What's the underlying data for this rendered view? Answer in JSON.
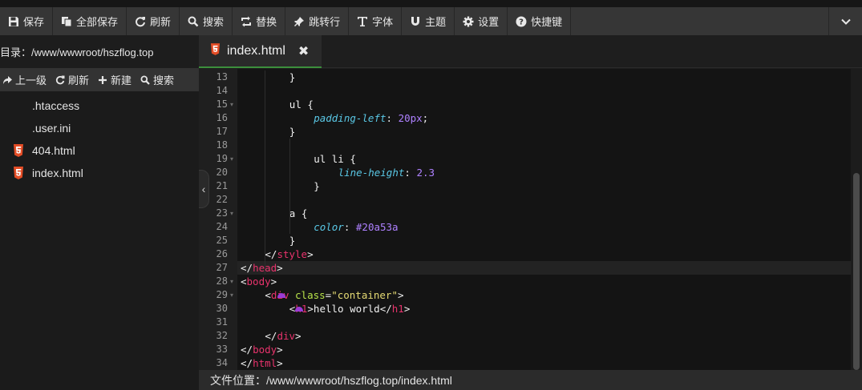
{
  "toolbar": {
    "buttons": [
      {
        "label": "保存",
        "icon": "floppy-icon"
      },
      {
        "label": "全部保存",
        "icon": "copy-icon"
      },
      {
        "label": "刷新",
        "icon": "refresh-icon"
      },
      {
        "label": "搜索",
        "icon": "search-icon"
      },
      {
        "label": "替换",
        "icon": "replace-icon"
      },
      {
        "label": "跳转行",
        "icon": "pin-icon"
      },
      {
        "label": "字体",
        "icon": "text-icon"
      },
      {
        "label": "主题",
        "icon": "magnet-icon"
      },
      {
        "label": "设置",
        "icon": "gear-icon"
      },
      {
        "label": "快捷键",
        "icon": "help-icon"
      }
    ],
    "collapse_icon": "chevron-down-icon"
  },
  "sidebar": {
    "directory_label": "目录：/www/wwwroot/hszflog.top",
    "nav": [
      {
        "label": "上一级",
        "icon": "share-icon"
      },
      {
        "label": "刷新",
        "icon": "refresh-icon"
      },
      {
        "label": "新建",
        "icon": "plus-icon"
      },
      {
        "label": "搜索",
        "icon": "search-icon"
      }
    ],
    "files": [
      {
        "name": ".htaccess",
        "icon": "blank-file-icon"
      },
      {
        "name": ".user.ini",
        "icon": "blank-file-icon"
      },
      {
        "name": "404.html",
        "icon": "html5-icon"
      },
      {
        "name": "index.html",
        "icon": "html5-icon"
      }
    ]
  },
  "tab": {
    "label": "index.html",
    "close": "✖"
  },
  "editor": {
    "lines": [
      {
        "num": "13",
        "fold": "",
        "indent": 8,
        "tokens": [
          {
            "t": "}",
            "c": "plain"
          }
        ]
      },
      {
        "num": "14",
        "fold": "",
        "indent": 0,
        "tokens": []
      },
      {
        "num": "15",
        "fold": "▾",
        "indent": 8,
        "tokens": [
          {
            "t": "ul {",
            "c": "plain"
          }
        ]
      },
      {
        "num": "16",
        "fold": "",
        "indent": 12,
        "tokens": [
          {
            "t": "padding-left",
            "c": "prop"
          },
          {
            "t": ": ",
            "c": "plain"
          },
          {
            "t": "20px",
            "c": "num"
          },
          {
            "t": ";",
            "c": "plain"
          }
        ]
      },
      {
        "num": "17",
        "fold": "",
        "indent": 8,
        "tokens": [
          {
            "t": "}",
            "c": "plain"
          }
        ]
      },
      {
        "num": "18",
        "fold": "",
        "indent": 0,
        "tokens": []
      },
      {
        "num": "19",
        "fold": "▾",
        "indent": 12,
        "tokens": [
          {
            "t": "ul li {",
            "c": "plain"
          }
        ]
      },
      {
        "num": "20",
        "fold": "",
        "indent": 16,
        "tokens": [
          {
            "t": "line-height",
            "c": "prop"
          },
          {
            "t": ": ",
            "c": "plain"
          },
          {
            "t": "2.3",
            "c": "num"
          }
        ]
      },
      {
        "num": "21",
        "fold": "",
        "indent": 12,
        "tokens": [
          {
            "t": "}",
            "c": "plain"
          }
        ]
      },
      {
        "num": "22",
        "fold": "",
        "indent": 0,
        "tokens": []
      },
      {
        "num": "23",
        "fold": "▾",
        "indent": 8,
        "tokens": [
          {
            "t": "a {",
            "c": "plain"
          }
        ]
      },
      {
        "num": "24",
        "fold": "",
        "indent": 12,
        "tokens": [
          {
            "t": "color",
            "c": "prop"
          },
          {
            "t": ": ",
            "c": "plain"
          },
          {
            "t": "#20a53a",
            "c": "num"
          }
        ]
      },
      {
        "num": "25",
        "fold": "",
        "indent": 8,
        "tokens": [
          {
            "t": "}",
            "c": "plain"
          }
        ]
      },
      {
        "num": "26",
        "fold": "",
        "indent": 4,
        "tokens": [
          {
            "t": "</",
            "c": "plain"
          },
          {
            "t": "style",
            "c": "tag"
          },
          {
            "t": ">",
            "c": "plain"
          }
        ]
      },
      {
        "num": "27",
        "fold": "",
        "indent": 0,
        "tokens": [
          {
            "t": "</",
            "c": "plain"
          },
          {
            "t": "head",
            "c": "tag"
          },
          {
            "t": ">",
            "c": "plain"
          }
        ],
        "active": true
      },
      {
        "num": "28",
        "fold": "▾",
        "indent": 0,
        "tokens": [
          {
            "t": "<",
            "c": "plain"
          },
          {
            "t": "body",
            "c": "tag"
          },
          {
            "t": ">",
            "c": "plain"
          }
        ]
      },
      {
        "num": "29",
        "fold": "▾",
        "indent": 4,
        "tokens": [
          {
            "t": "<",
            "c": "plain"
          },
          {
            "t": "div",
            "c": "tag"
          },
          {
            "t": " ",
            "c": "plain"
          },
          {
            "t": "class",
            "c": "attr"
          },
          {
            "t": "=",
            "c": "plain"
          },
          {
            "t": "\"container\"",
            "c": "str"
          },
          {
            "t": ">",
            "c": "plain"
          }
        ]
      },
      {
        "num": "30",
        "fold": "",
        "indent": 8,
        "tokens": [
          {
            "t": "<",
            "c": "plain"
          },
          {
            "t": "h1",
            "c": "tag"
          },
          {
            "t": ">hello world</",
            "c": "plain"
          },
          {
            "t": "h1",
            "c": "tag"
          },
          {
            "t": ">",
            "c": "plain"
          }
        ]
      },
      {
        "num": "31",
        "fold": "",
        "indent": 0,
        "tokens": []
      },
      {
        "num": "32",
        "fold": "",
        "indent": 4,
        "tokens": [
          {
            "t": "</",
            "c": "plain"
          },
          {
            "t": "div",
            "c": "tag"
          },
          {
            "t": ">",
            "c": "plain"
          }
        ]
      },
      {
        "num": "33",
        "fold": "",
        "indent": 0,
        "tokens": [
          {
            "t": "</",
            "c": "plain"
          },
          {
            "t": "body",
            "c": "tag"
          },
          {
            "t": ">",
            "c": "plain"
          }
        ]
      },
      {
        "num": "34",
        "fold": "",
        "indent": 0,
        "tokens": [
          {
            "t": "</",
            "c": "plain"
          },
          {
            "t": "html",
            "c": "tag"
          },
          {
            "t": ">",
            "c": "plain"
          }
        ]
      }
    ]
  },
  "statusbar": {
    "path": "文件位置：/www/wwwroot/hszflog.top/index.html"
  },
  "colors": {
    "accent_tab": "#3c8f3c",
    "tag": "#e8336c",
    "attr": "#b8e34a",
    "string": "#e6db74",
    "property": "#5ac8e6",
    "number": "#ae81ff",
    "html5_icon": "#e44d26"
  }
}
